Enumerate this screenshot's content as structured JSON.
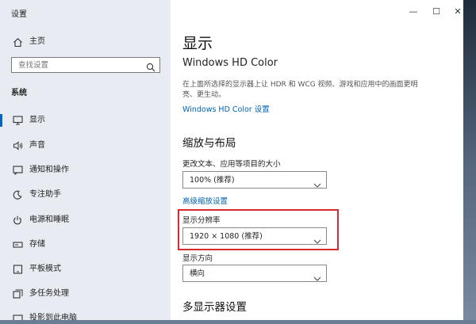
{
  "window": {
    "title": "设置",
    "controls": {
      "minimize": "—",
      "maximize": "☐",
      "close": "✕"
    }
  },
  "sidebar": {
    "home_label": "主页",
    "search_placeholder": "查找设置",
    "section_label": "系统",
    "items": [
      {
        "label": "显示",
        "icon": "monitor-icon",
        "active": true
      },
      {
        "label": "声音",
        "icon": "speaker-icon"
      },
      {
        "label": "通知和操作",
        "icon": "notification-icon"
      },
      {
        "label": "专注助手",
        "icon": "moon-icon"
      },
      {
        "label": "电源和睡眠",
        "icon": "power-icon"
      },
      {
        "label": "存储",
        "icon": "storage-icon"
      },
      {
        "label": "平板模式",
        "icon": "tablet-icon"
      },
      {
        "label": "多任务处理",
        "icon": "multitask-icon"
      },
      {
        "label": "投影到此电脑",
        "icon": "projection-icon"
      }
    ]
  },
  "main": {
    "title": "显示",
    "hdr_heading": "Windows HD Color",
    "hdr_description": "在上面所选择的显示器上让 HDR 和 WCG 视频、游戏和应用中的画面更明亮、更生动。",
    "hdr_link": "Windows HD Color 设置",
    "scale_heading": "缩放与布局",
    "scale_label": "更改文本、应用等项目的大小",
    "scale_value": "100% (推荐)",
    "advanced_scaling_link": "高级缩放设置",
    "resolution_label": "显示分辨率",
    "resolution_value": "1920 × 1080 (推荐)",
    "orientation_label": "显示方向",
    "orientation_value": "横向",
    "multi_display_heading": "多显示器设置"
  },
  "colors": {
    "accent": "#0067c0",
    "highlight": "#d82a2a",
    "sidebar_bg": "#e8ecf2"
  }
}
